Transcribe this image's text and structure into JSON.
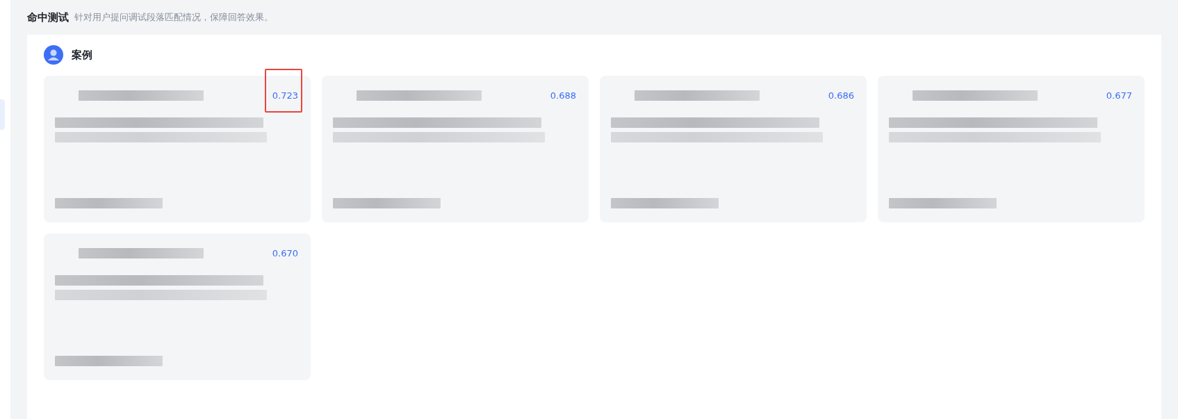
{
  "header": {
    "title": "命中测试",
    "description": "针对用户提问调试段落匹配情况，保障回答效果。"
  },
  "panel": {
    "title": "案例",
    "cards": [
      {
        "score": "0.723",
        "highlighted": true
      },
      {
        "score": "0.688",
        "highlighted": false
      },
      {
        "score": "0.686",
        "highlighted": false
      },
      {
        "score": "0.677",
        "highlighted": false
      },
      {
        "score": "0.670",
        "highlighted": false
      }
    ]
  }
}
